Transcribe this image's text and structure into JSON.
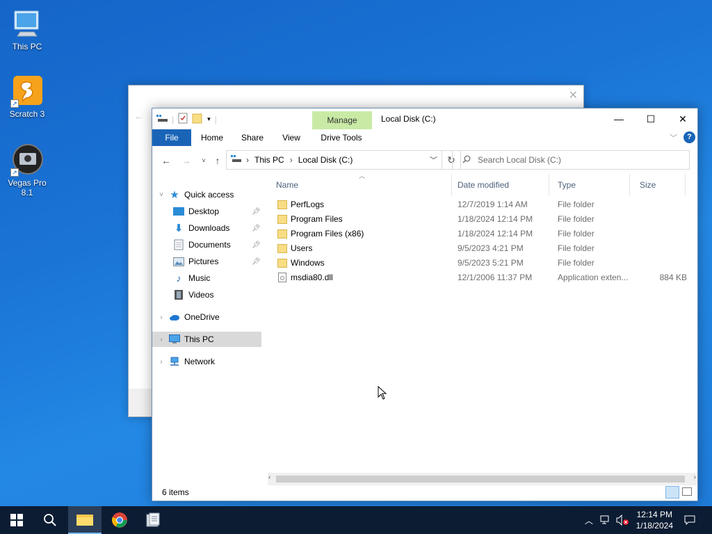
{
  "desktop": {
    "icons": [
      {
        "label": "This PC"
      },
      {
        "label": "Scratch 3"
      },
      {
        "label": "Vegas Pro 8.1"
      }
    ]
  },
  "explorer": {
    "title": "Local Disk (C:)",
    "manage_tab": "Manage",
    "ribbon_tabs": [
      "File",
      "Home",
      "Share",
      "View",
      "Drive Tools"
    ],
    "address": {
      "crumbs": [
        "This PC",
        "Local Disk (C:)"
      ]
    },
    "search_placeholder": "Search Local Disk (C:)",
    "nav": {
      "quick_access": "Quick access",
      "desktop": "Desktop",
      "downloads": "Downloads",
      "documents": "Documents",
      "pictures": "Pictures",
      "music": "Music",
      "videos": "Videos",
      "onedrive": "OneDrive",
      "this_pc": "This PC",
      "network": "Network"
    },
    "columns": {
      "name": "Name",
      "date": "Date modified",
      "type": "Type",
      "size": "Size"
    },
    "files": [
      {
        "name": "PerfLogs",
        "date": "12/7/2019 1:14 AM",
        "type": "File folder",
        "size": "",
        "kind": "folder"
      },
      {
        "name": "Program Files",
        "date": "1/18/2024 12:14 PM",
        "type": "File folder",
        "size": "",
        "kind": "folder"
      },
      {
        "name": "Program Files (x86)",
        "date": "1/18/2024 12:14 PM",
        "type": "File folder",
        "size": "",
        "kind": "folder"
      },
      {
        "name": "Users",
        "date": "9/5/2023 4:21 PM",
        "type": "File folder",
        "size": "",
        "kind": "folder"
      },
      {
        "name": "Windows",
        "date": "9/5/2023 5:21 PM",
        "type": "File folder",
        "size": "",
        "kind": "folder"
      },
      {
        "name": "msdia80.dll",
        "date": "12/1/2006 11:37 PM",
        "type": "Application exten...",
        "size": "884 KB",
        "kind": "dll"
      }
    ],
    "status": "6 items"
  },
  "taskbar": {
    "time": "12:14 PM",
    "date": "1/18/2024"
  },
  "colors": {
    "accent": "#1a64b8",
    "manage_tab": "#c9eaa5",
    "folder": "#f5d66b",
    "taskbar": "#0c1c33"
  }
}
